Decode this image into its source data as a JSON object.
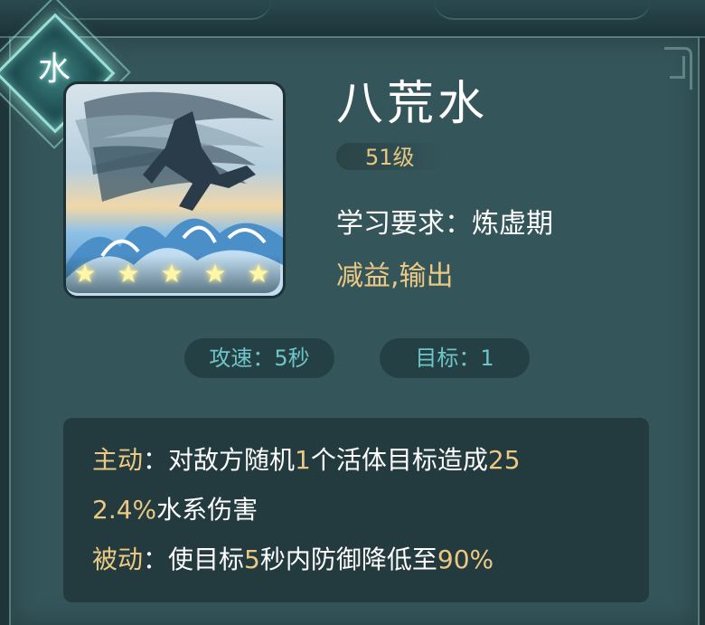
{
  "element": {
    "label": "水"
  },
  "skill": {
    "name": "八荒水",
    "level": "51级",
    "requirement": "学习要求：炼虚期",
    "tags": "减益,输出",
    "stars": 5
  },
  "stats": {
    "speed": "攻速：5秒",
    "target": "目标：1"
  },
  "description": {
    "active_label": "主动",
    "active_text_1": "：对敌方随机",
    "active_num_1": "1",
    "active_text_2": "个活体目标造成",
    "active_num_2a": "25",
    "active_num_2b": "2.4%",
    "active_text_3": "水系伤害",
    "passive_label": "被动",
    "passive_text_1": "：使目标",
    "passive_num_1": "5",
    "passive_text_2": "秒内防御降低至",
    "passive_num_2": "90%"
  },
  "colors": {
    "accent_gold": "#ebc982",
    "stat_text": "#6ec5c9",
    "panel_bg": "#34555a"
  }
}
